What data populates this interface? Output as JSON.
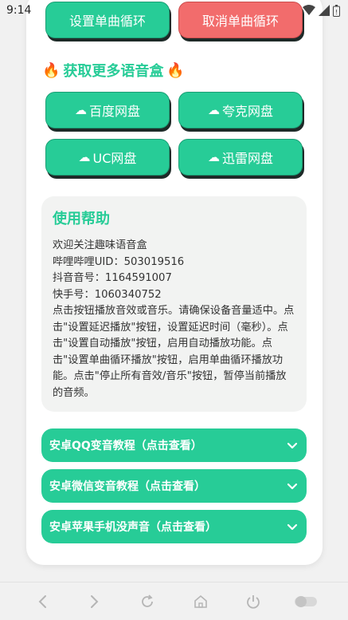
{
  "status_bar": {
    "time": "9:14"
  },
  "top_buttons": {
    "left": "设置单曲循环",
    "right": "取消单曲循环"
  },
  "section": {
    "title": "获取更多语音盒"
  },
  "cloud_buttons": [
    {
      "label": "百度网盘"
    },
    {
      "label": "夸克网盘"
    },
    {
      "label": "UC网盘"
    },
    {
      "label": "迅雷网盘"
    }
  ],
  "help": {
    "title": "使用帮助",
    "lines": [
      "欢迎关注趣味语音盒",
      "哔哩哔哩UID：503019516",
      "抖音音号：1164591007",
      "快手号：1060340752",
      "点击按钮播放音效或音乐。请确保设备音量适中。点击\"设置延迟播放\"按钮，设置延迟时间（毫秒）。点击\"设置自动播放\"按钮，启用自动播放功能。点击\"设置单曲循环播放\"按钮，启用单曲循环播放功能。点击\"停止所有音效/音乐\"按钮，暂停当前播放的音频。"
    ]
  },
  "accordions": [
    {
      "label": "安卓QQ变音教程（点击查看）"
    },
    {
      "label": "安卓微信变音教程（点击查看）"
    },
    {
      "label": "安卓苹果手机没声音（点击查看）"
    }
  ],
  "colors": {
    "accent": "#27cc97",
    "danger": "#f26c6c"
  },
  "icons": [
    "fire-icon",
    "cloud-icon",
    "chevron-down-icon",
    "back-icon",
    "forward-icon",
    "reload-icon",
    "home-icon",
    "power-icon",
    "toggle-icon"
  ]
}
